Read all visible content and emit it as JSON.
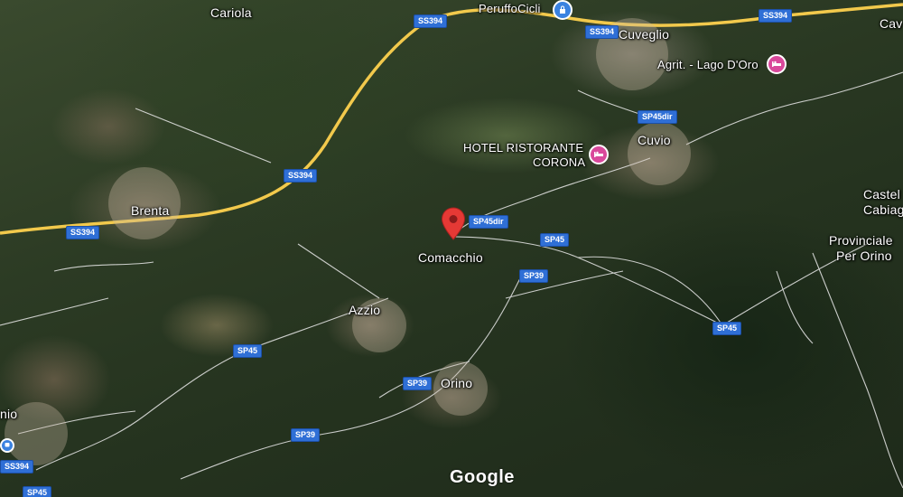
{
  "map": {
    "places": [
      {
        "id": "cariola",
        "text": "Cariola"
      },
      {
        "id": "brenta",
        "text": "Brenta"
      },
      {
        "id": "comacchio",
        "text": "Comacchio"
      },
      {
        "id": "azzio",
        "text": "Azzio"
      },
      {
        "id": "orino",
        "text": "Orino"
      },
      {
        "id": "cuvio",
        "text": "Cuvio"
      },
      {
        "id": "cuveglio",
        "text": "Cuveglio"
      },
      {
        "id": "castel",
        "text": "Castel"
      },
      {
        "id": "cabiag",
        "text": "Cabiag"
      },
      {
        "id": "provinciale",
        "text": "Provinciale"
      },
      {
        "id": "per-orino",
        "text": "Per Orino"
      },
      {
        "id": "nio",
        "text": "nio"
      },
      {
        "id": "cav",
        "text": "Cav"
      }
    ],
    "pois": [
      {
        "id": "peruffocicli",
        "text": "PeruffoCicli",
        "icon": "shopping-bag-icon"
      },
      {
        "id": "hotel-corona-1",
        "text": "HOTEL RISTORANTE"
      },
      {
        "id": "hotel-corona-2",
        "text": "CORONA",
        "icon": "hotel-bed-icon"
      },
      {
        "id": "agrit",
        "text": "Agrit. - Lago D'Oro",
        "icon": "hotel-bed-icon"
      }
    ],
    "road_shields": {
      "ss394_a": "SS394",
      "ss394_b": "SS394",
      "ss394_c": "SS394",
      "ss394_d": "SS394",
      "ss394_e": "SS394",
      "ss394_f": "SS394",
      "sp45dir_a": "SP45dir",
      "sp45dir_b": "SP45dir",
      "sp45_a": "SP45",
      "sp45_b": "SP45",
      "sp45_c": "SP45",
      "sp45_d": "SP45",
      "sp39_a": "SP39",
      "sp39_b": "SP39",
      "sp39_c": "SP39"
    },
    "selected_pin_icon": "location-pin-icon",
    "attribution": "Google",
    "colors": {
      "highway": "#f2c94c",
      "road": "#e8e8e8",
      "shield": "#2f6fd6",
      "pin": "#e53935",
      "poi_pink": "#d9489b"
    }
  }
}
